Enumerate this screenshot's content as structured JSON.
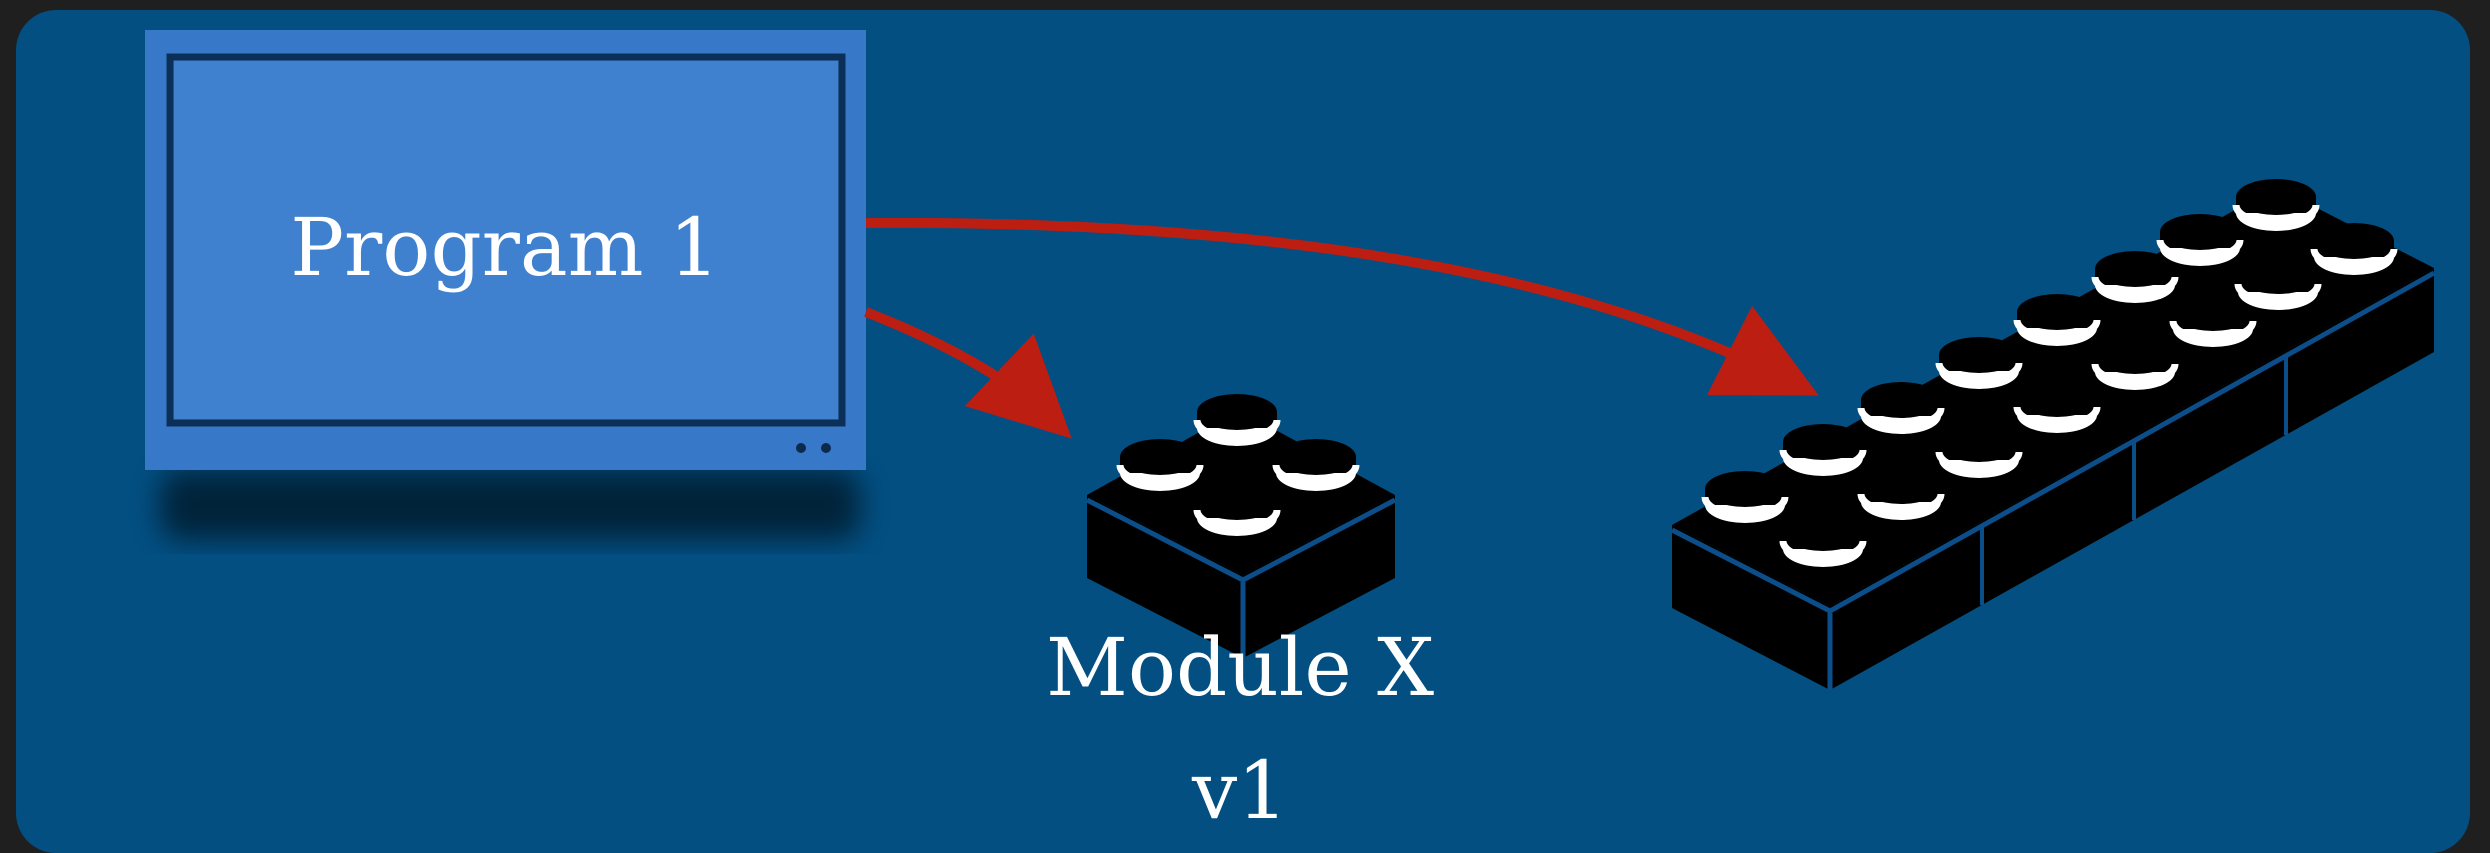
{
  "diagram": {
    "program_label": "Program 1",
    "module_label_line1": "Module X",
    "module_label_line2": "v1"
  },
  "colors": {
    "slide_background": "#034f82",
    "window_frame": "#3878c8",
    "window_screen": "#3f80cf",
    "arrow": "#bc1e12",
    "brick": "#000000",
    "stud_highlight": "#ffffff"
  },
  "icons": [
    "monitor-icon",
    "lego-brick-2x2-icon",
    "lego-brick-2x8-icon"
  ]
}
